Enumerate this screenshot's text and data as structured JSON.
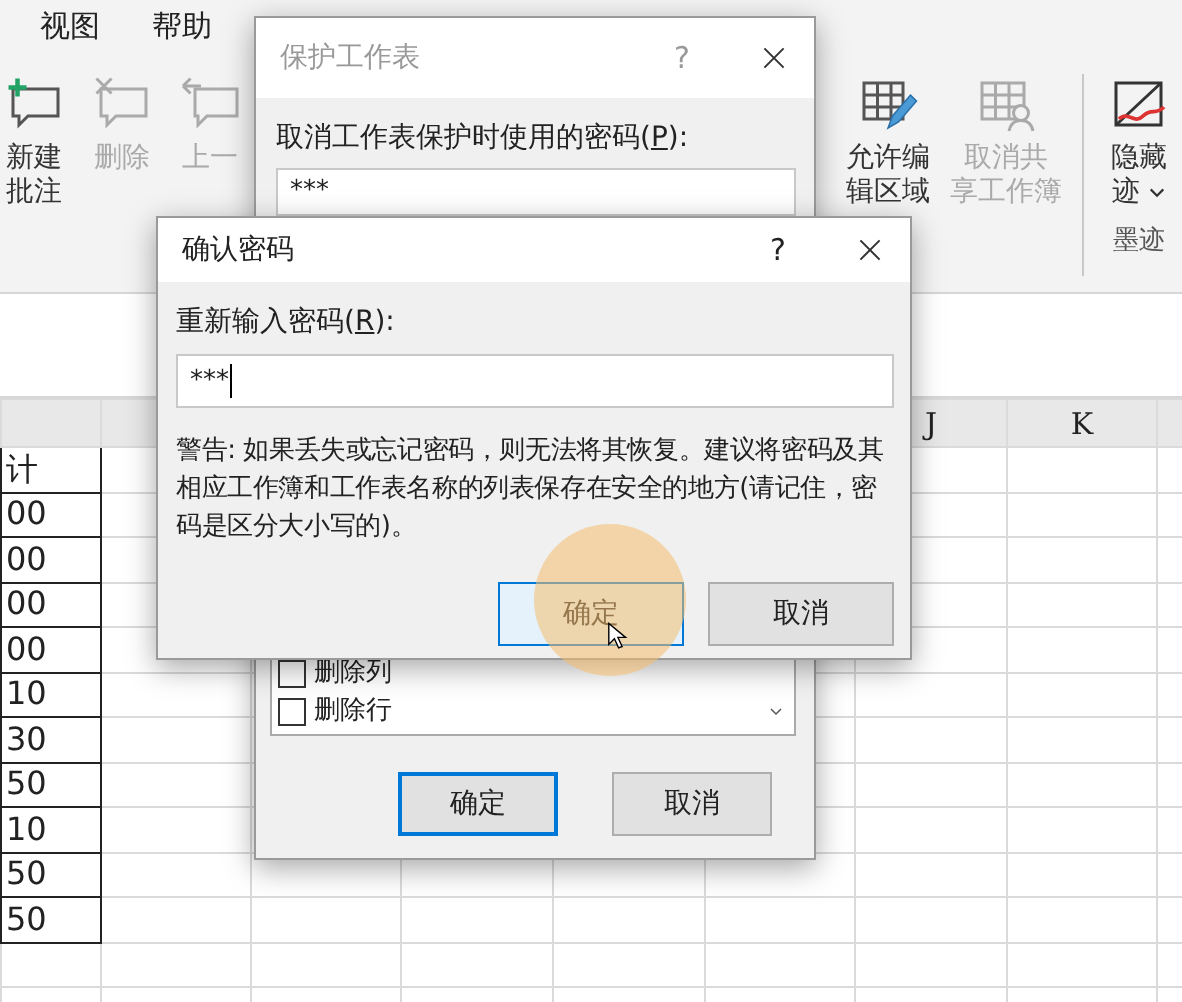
{
  "ribbon_tabs": [
    {
      "label": "视图"
    },
    {
      "label": "帮助"
    }
  ],
  "ribbon_left": [
    {
      "kind": "new-comment",
      "lines": [
        "新建",
        "批注"
      ],
      "disabled": false
    },
    {
      "kind": "delete-comment",
      "lines": [
        "删除"
      ],
      "disabled": true
    },
    {
      "kind": "previous-comment",
      "lines": [
        "上一"
      ],
      "disabled": true
    }
  ],
  "ribbon_right": [
    {
      "kind": "edit-ranges",
      "lines": [
        "允许编",
        "辑区域"
      ],
      "disabled": false
    },
    {
      "kind": "unshare",
      "lines": [
        "取消共",
        "享工作簿"
      ],
      "disabled": true
    }
  ],
  "ink_group": {
    "button": {
      "kind": "hide-ink",
      "lines": [
        "隐藏",
        "迹"
      ],
      "disabled": false,
      "dropdown": true
    },
    "label": "墨迹"
  },
  "sheet": {
    "column_headers": [
      {
        "label": "J"
      },
      {
        "label": "K"
      }
    ],
    "column_a": [
      "计",
      "00",
      "00",
      "00",
      "00",
      "10",
      "30",
      "50",
      "10",
      "50",
      "50"
    ]
  },
  "protect_dialog": {
    "title": "保护工作表",
    "active": false,
    "help": "?",
    "password_label": [
      "取消工作表保护时使用的密码(",
      "P",
      "):"
    ],
    "password_value": "***",
    "options": [
      {
        "label": "删除列",
        "checked": false
      },
      {
        "label": "删除行",
        "checked": false
      }
    ],
    "buttons": [
      {
        "label": "确定",
        "default": true,
        "focused": false
      },
      {
        "label": "取消",
        "default": false,
        "focused": false
      }
    ]
  },
  "confirm_dialog": {
    "title": "确认密码",
    "active": true,
    "help": "?",
    "password_label": [
      "重新输入密码(",
      "R",
      "):"
    ],
    "password_value": "***",
    "warning": "警告: 如果丢失或忘记密码，则无法将其恢复。建议将密码及其相应工作簿和工作表名称的列表保存在安全的地方(请记住，密码是区分大小写的)。",
    "buttons": [
      {
        "label": "确定",
        "default": true,
        "focused": true
      },
      {
        "label": "取消",
        "default": false,
        "focused": false
      }
    ]
  }
}
